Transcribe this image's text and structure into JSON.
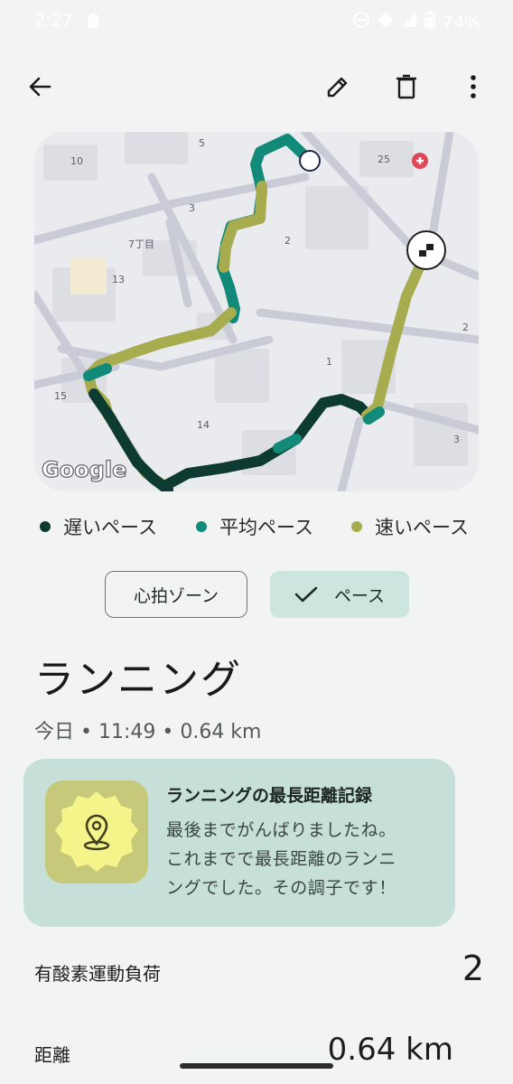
{
  "status_bar": {
    "time": "2:27",
    "battery": "74%"
  },
  "toolbar": {
    "back_icon": "arrow-left-icon",
    "edit_icon": "pencil-icon",
    "delete_icon": "trash-icon",
    "more_icon": "more-vert-icon"
  },
  "map": {
    "labels": [
      "5",
      "10",
      "25",
      "3",
      "2",
      "7丁目",
      "13",
      "2",
      "1",
      "15",
      "14",
      "3"
    ],
    "logo": "Google"
  },
  "legend": {
    "slow": {
      "label": "遅いペース",
      "color": "#0d3b32"
    },
    "avg": {
      "label": "平均ペース",
      "color": "#128a7a"
    },
    "fast": {
      "label": "速いペース",
      "color": "#a7ad4f"
    }
  },
  "chips": {
    "heart_rate": "心拍ゾーン",
    "pace": "ペース"
  },
  "activity": {
    "title": "ランニング",
    "subtitle": "今日 • 11:49 • 0.64 km"
  },
  "achievement": {
    "title": "ランニングの最長距離記録",
    "line1": "最後までがんばりましたね。",
    "line2": "これまでで最長距離のランニ",
    "line3": "ングでした。その調子です！"
  },
  "metrics": {
    "cardio_label": "有酸素運動負荷",
    "cardio_value": "2",
    "distance_label": "距離",
    "distance_value": "0.64 km"
  }
}
